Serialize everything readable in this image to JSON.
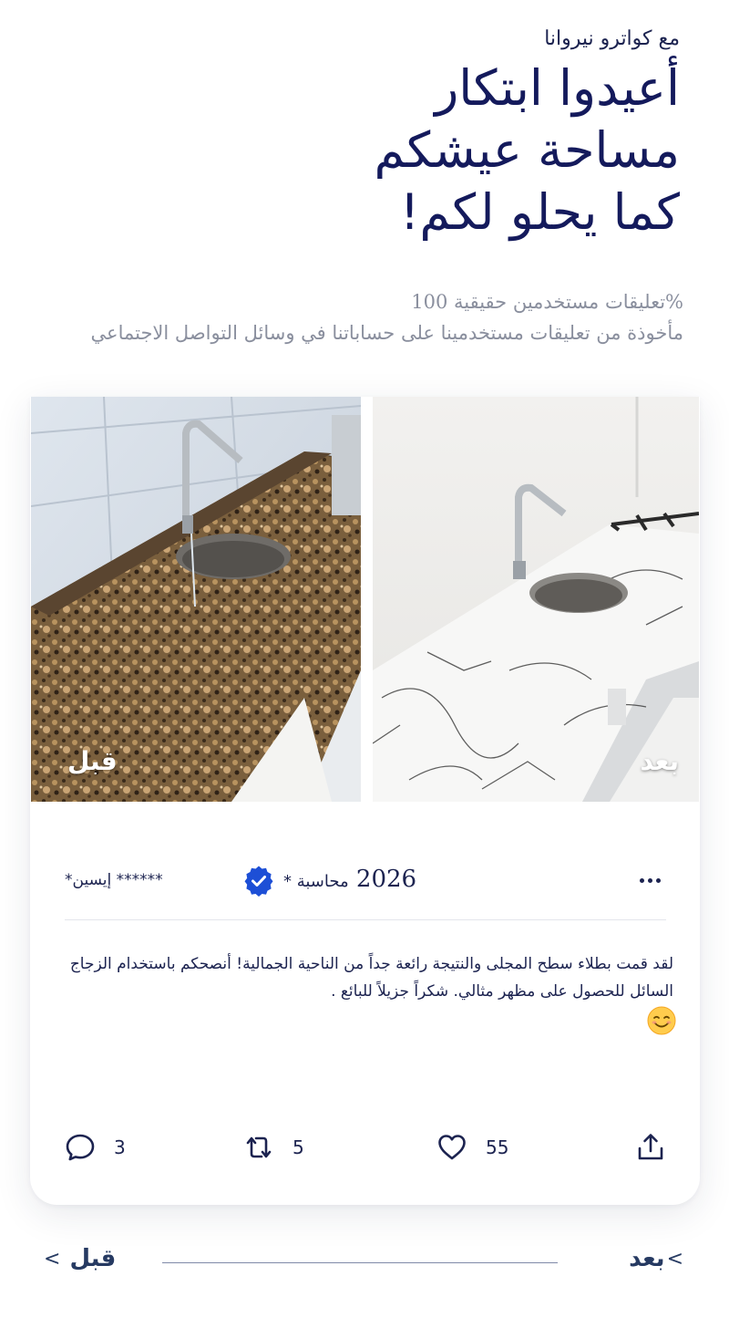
{
  "hero": {
    "brand_line": "مع كواترو نيروانا",
    "headline_lines": [
      "أعيدوا ابتكار",
      "مساحة عيشكم",
      "كما يحلو لكم!"
    ]
  },
  "stats": {
    "line1": "%تعليقات مستخدمين حقيقية 100",
    "line2": "مأخوذة من تعليقات مستخدمينا على حساباتنا في وسائل التواصل الاجتماعي"
  },
  "photos": {
    "before_label": "قبل",
    "after_label": "بعد"
  },
  "post": {
    "username": "****** إيسين*",
    "verified_icon": "verified-badge-icon",
    "year": "2026",
    "role": "محاسبة *",
    "text": "لقد قمت بطلاء سطح المجلى والنتيجة رائعة جداً من الناحية الجمالية! أنصحكم باستخدام الزجاج السائل للحصول على مظهر مثالي. شكراً جزيلاً للبائع .",
    "emoji": "smiling-face-emoji"
  },
  "actions": {
    "replies": "3",
    "reposts": "5",
    "likes": "55"
  },
  "nav": {
    "prev_label": "قبل",
    "next_label": "بعد",
    "prev_chevron": "<",
    "next_chevron": "<"
  },
  "colors": {
    "brand_navy": "#141a5c",
    "muted_text": "#8a8f9e",
    "verified_blue": "#1d4fd6"
  }
}
